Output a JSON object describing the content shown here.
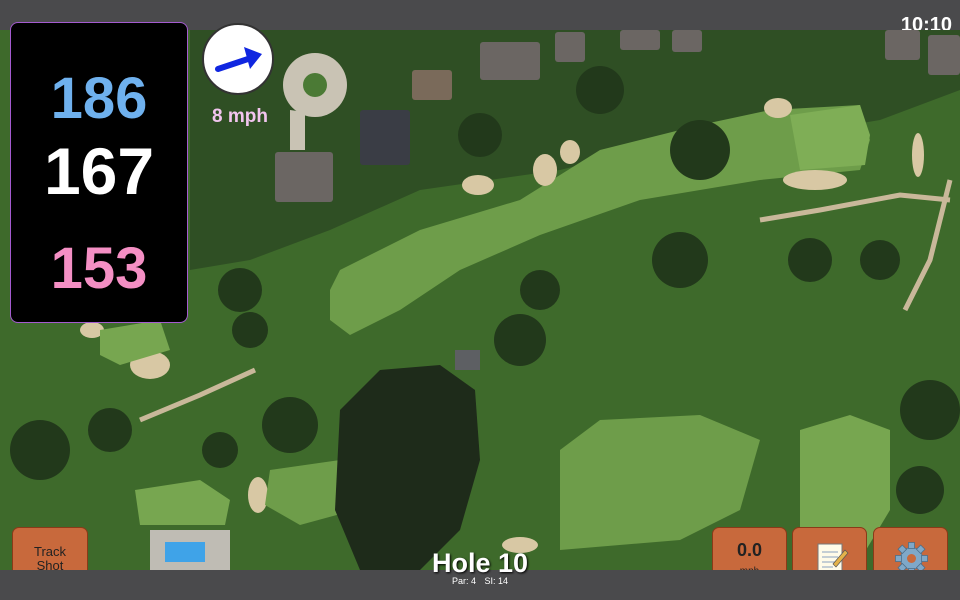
{
  "status": {
    "time": "10:10"
  },
  "distances": {
    "back": "186",
    "middle": "167",
    "front": "153"
  },
  "wind": {
    "speed": "8 mph",
    "icon": "wind-direction-arrow-icon"
  },
  "hole": {
    "title": "Hole 10",
    "par": "Par: 4",
    "stroke_index": "SI: 14"
  },
  "buttons": {
    "track_shot": "Track\nShot",
    "speed_value": "0.0",
    "speed_unit": "mph",
    "notes_icon": "notepad-icon",
    "settings_icon": "gear-icon"
  },
  "colors": {
    "back": "#6fb1ee",
    "middle": "#ffffff",
    "front": "#f48fc4",
    "button": "#c8693c",
    "panel_border": "#a45bd0"
  }
}
